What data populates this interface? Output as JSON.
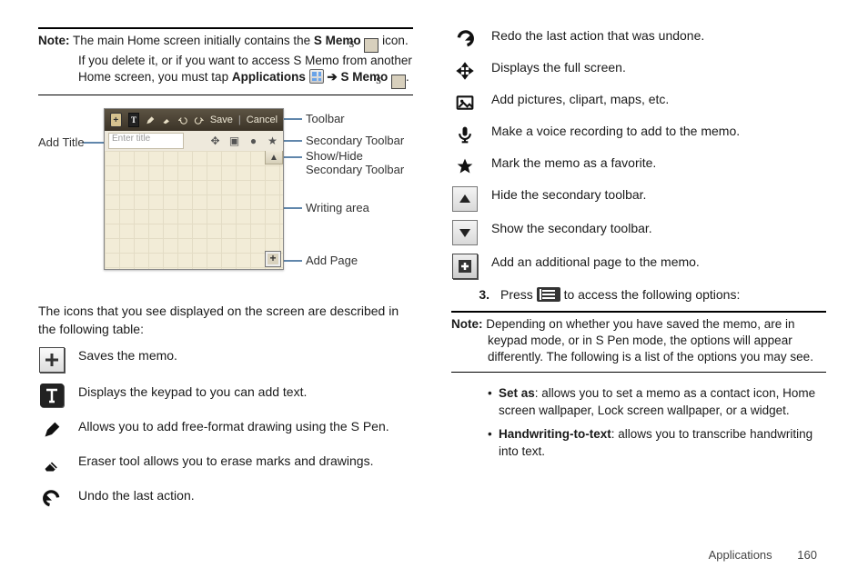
{
  "note_top": {
    "label": "Note:",
    "t1": " The main Home screen initially contains the ",
    "bold1": "S Memo",
    "t2": "  icon. If you delete it, or if you want to access S Memo from another Home screen, you must tap ",
    "bold2": "Applications",
    "arrow": " ➔ ",
    "bold3": "S Memo",
    "period": "."
  },
  "screen_label_s": "S",
  "screen_label_s2": "S",
  "toolbar_text_T": "T",
  "toolbar_plus": "+",
  "toolbar_save": "Save",
  "toolbar_cancel": "Cancel",
  "title_placeholder": "Enter title",
  "addpage_plus": "+",
  "callouts": {
    "add_title": "Add Title",
    "toolbar": "Toolbar",
    "sec_toolbar": "Secondary Toolbar",
    "show_hide": "Show/Hide",
    "show_hide_line2": "Secondary Toolbar",
    "writing_area": "Writing area",
    "add_page": "Add Page"
  },
  "intro_para": "The icons that you see displayed on the screen are described in the following table:",
  "icons_left": [
    {
      "label": "Saves the memo."
    },
    {
      "label": "Displays the keypad to you can add text."
    },
    {
      "label": "Allows you to add free-format drawing using the S Pen."
    },
    {
      "label": "Eraser tool allows you to erase marks and drawings."
    },
    {
      "label": "Undo the last action."
    }
  ],
  "icons_right": [
    {
      "label": "Redo the last action that was undone."
    },
    {
      "label": "Displays the full screen."
    },
    {
      "label": "Add pictures, clipart, maps, etc."
    },
    {
      "label": "Make a voice recording to add to the memo."
    },
    {
      "label": "Mark the memo as a favorite."
    },
    {
      "label": "Hide the secondary toolbar."
    },
    {
      "label": "Show the secondary toolbar."
    },
    {
      "label": "Add an additional page to the memo."
    }
  ],
  "step3_num": "3.",
  "step3_a": "Press ",
  "step3_b": " to access the following options:",
  "note_right": {
    "label": "Note:",
    "text": " Depending on whether you have saved the memo, are in keypad mode, or in S Pen mode, the options will appear differently. The following is a list of the options you may see."
  },
  "bullets": [
    {
      "bold": "Set as",
      "text": ": allows you to set a memo as a contact icon, Home screen wallpaper, Lock screen wallpaper, or a widget."
    },
    {
      "bold": "Handwriting-to-text",
      "text": ": allows you to transcribe handwriting into text."
    }
  ],
  "footer_section": "Applications",
  "footer_page": "160"
}
